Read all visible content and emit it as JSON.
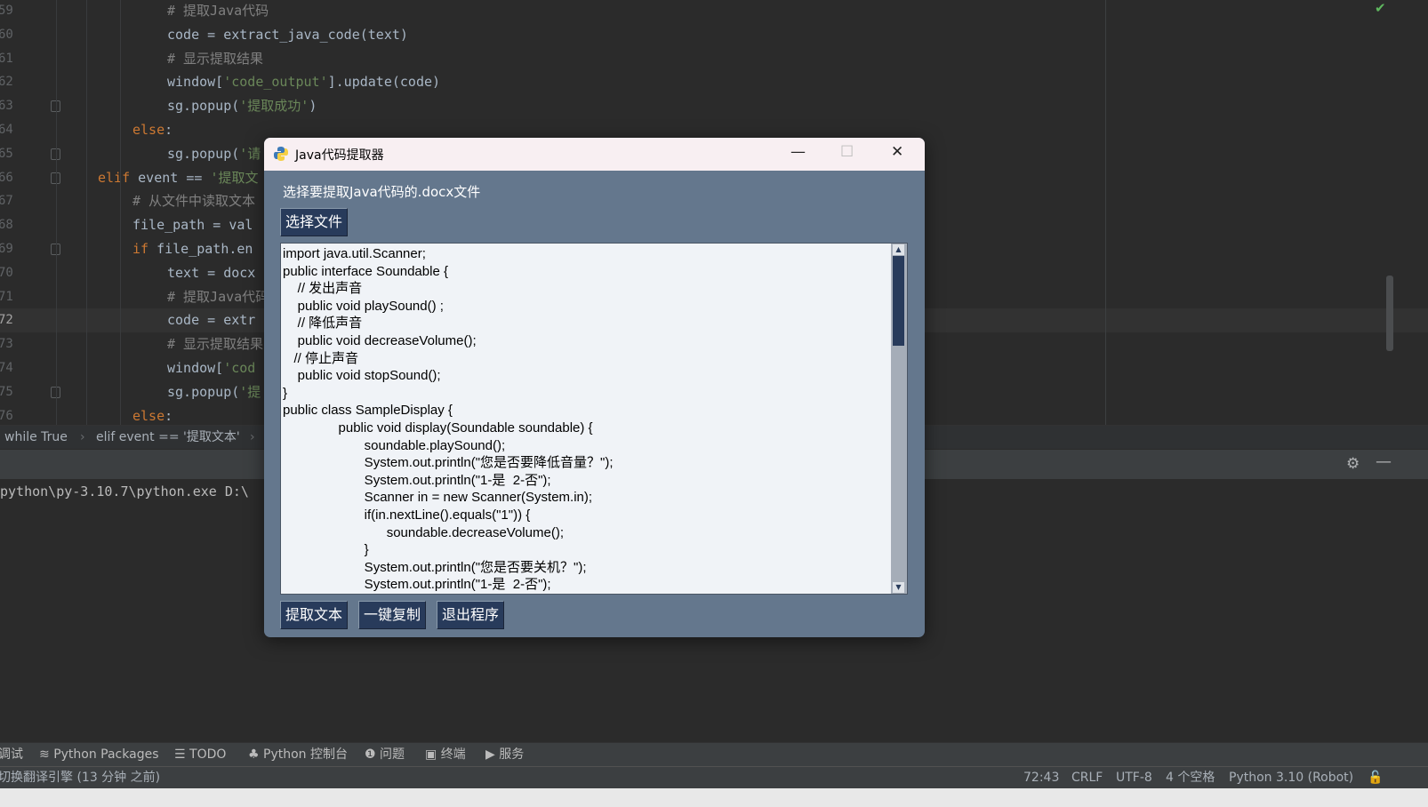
{
  "editor": {
    "lines": [
      {
        "num": "59",
        "parts": [
          {
            "t": "# 提取Java代码",
            "c": "cm"
          }
        ],
        "indent": 188
      },
      {
        "num": "60",
        "parts": [
          {
            "t": "code = extract_java_code(text)",
            "c": ""
          }
        ],
        "indent": 188
      },
      {
        "num": "61",
        "parts": [
          {
            "t": "# 显示提取结果",
            "c": "cm"
          }
        ],
        "indent": 188
      },
      {
        "num": "62",
        "parts": [
          {
            "t": "window[",
            "c": ""
          },
          {
            "t": "'code_output'",
            "c": "str"
          },
          {
            "t": "].update(code)",
            "c": ""
          }
        ],
        "indent": 188
      },
      {
        "num": "63",
        "parts": [
          {
            "t": "sg.popup(",
            "c": ""
          },
          {
            "t": "'提取成功'",
            "c": "str"
          },
          {
            "t": ")",
            "c": ""
          }
        ],
        "indent": 188
      },
      {
        "num": "64",
        "parts": [
          {
            "t": "else",
            "c": "kw"
          },
          {
            "t": ":",
            "c": ""
          }
        ],
        "indent": 149
      },
      {
        "num": "65",
        "parts": [
          {
            "t": "sg.popup(",
            "c": ""
          },
          {
            "t": "'请",
            "c": "str"
          }
        ],
        "indent": 188
      },
      {
        "num": "66",
        "parts": [
          {
            "t": "elif",
            "c": "kw"
          },
          {
            "t": " event == ",
            "c": ""
          },
          {
            "t": "'提取文",
            "c": "str"
          }
        ],
        "indent": 110
      },
      {
        "num": "67",
        "parts": [
          {
            "t": "# 从文件中读取文本",
            "c": "cm"
          }
        ],
        "indent": 149
      },
      {
        "num": "68",
        "parts": [
          {
            "t": "file_path = val",
            "c": ""
          }
        ],
        "indent": 149
      },
      {
        "num": "69",
        "parts": [
          {
            "t": "if",
            "c": "kw"
          },
          {
            "t": " file_path.en",
            "c": ""
          }
        ],
        "indent": 149
      },
      {
        "num": "70",
        "parts": [
          {
            "t": "text = docx",
            "c": ""
          }
        ],
        "indent": 188
      },
      {
        "num": "71",
        "parts": [
          {
            "t": "# 提取Java代码",
            "c": "cm"
          }
        ],
        "indent": 188
      },
      {
        "num": "72",
        "parts": [
          {
            "t": "code = extr",
            "c": ""
          }
        ],
        "indent": 188
      },
      {
        "num": "73",
        "parts": [
          {
            "t": "# 显示提取结果",
            "c": "cm"
          }
        ],
        "indent": 188
      },
      {
        "num": "74",
        "parts": [
          {
            "t": "window[",
            "c": ""
          },
          {
            "t": "'cod",
            "c": "str"
          }
        ],
        "indent": 188
      },
      {
        "num": "75",
        "parts": [
          {
            "t": "sg.popup(",
            "c": ""
          },
          {
            "t": "'提",
            "c": "str"
          }
        ],
        "indent": 188
      },
      {
        "num": "76",
        "parts": [
          {
            "t": "else",
            "c": "kw"
          },
          {
            "t": ":",
            "c": ""
          }
        ],
        "indent": 149
      }
    ],
    "current_line": "72"
  },
  "breadcrumb": {
    "items": [
      "while True",
      "elif event == '提取文本'"
    ]
  },
  "console": {
    "text": "python\\py-3.10.7\\python.exe D:\\"
  },
  "tool_windows": [
    {
      "label": "调试",
      "icon": "debug-icon"
    },
    {
      "label": "Python Packages",
      "icon": "layers-icon"
    },
    {
      "label": "TODO",
      "icon": "list-icon"
    },
    {
      "label": "Python 控制台",
      "icon": "python-icon"
    },
    {
      "label": "问题",
      "icon": "problems-icon"
    },
    {
      "label": "终端",
      "icon": "terminal-icon"
    },
    {
      "label": "服务",
      "icon": "play-icon"
    }
  ],
  "status": {
    "message": "切换翻译引擎 (13 分钟 之前)",
    "position": "72:43",
    "line_sep": "CRLF",
    "encoding": "UTF-8",
    "indent": "4 个空格",
    "interpreter": "Python 3.10 (Robot)"
  },
  "dialog": {
    "title": "Java代码提取器",
    "prompt": "选择要提取Java代码的.docx文件",
    "choose_button": "选择文件",
    "code_text": "import java.util.Scanner;\npublic interface Soundable {\n    // 发出声音\n    public void playSound() ;\n    // 降低声音\n    public void decreaseVolume();\n   // 停止声音\n    public void stopSound();\n}\npublic class SampleDisplay {\n               public void display(Soundable soundable) {\n                      soundable.playSound();\n                      System.out.println(\"您是否要降低音量？\");\n                      System.out.println(\"1-是  2-否\");\n                      Scanner in = new Scanner(System.in);\n                      if(in.nextLine().equals(\"1\")) {\n                            soundable.decreaseVolume();\n                      }\n                      System.out.println(\"您是否要关机？\");\n                      System.out.println(\"1-是  2-否\");",
    "extract_button": "提取文本",
    "copy_button": "一键复制",
    "exit_button": "退出程序",
    "scroll_position": 0.0
  },
  "colors": {
    "dialog_bg": "#64778d",
    "button_bg": "#283b5b",
    "editor_bg": "#2b2b2b"
  }
}
